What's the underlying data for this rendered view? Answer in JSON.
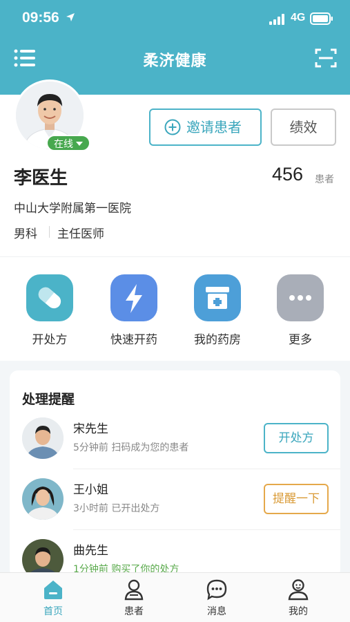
{
  "status_bar": {
    "time": "09:56",
    "network": "4G"
  },
  "navbar": {
    "title": "柔济健康"
  },
  "profile": {
    "online_label": "在线",
    "invite_label": "邀请患者",
    "performance_label": "绩效",
    "name": "李医生",
    "patient_count": "456",
    "patient_unit": "患者",
    "hospital": "中山大学附属第一医院",
    "department": "男科",
    "title": "主任医师"
  },
  "quick_actions": [
    {
      "label": "开处方",
      "icon": "pill-icon",
      "color": "#4bb3c8"
    },
    {
      "label": "快速开药",
      "icon": "lightning-icon",
      "color": "#5b8ee6"
    },
    {
      "label": "我的药房",
      "icon": "pharmacy-icon",
      "color": "#4d9fd8"
    },
    {
      "label": "更多",
      "icon": "more-icon",
      "color": "#a9aeb8"
    }
  ],
  "reminders": {
    "title": "处理提醒",
    "items": [
      {
        "name": "宋先生",
        "desc": "5分钟前  扫码成为您的患者",
        "action": "开处方"
      },
      {
        "name": "王小姐",
        "desc": "3小时前  已开出处方",
        "action": "提醒一下"
      },
      {
        "name": "曲先生",
        "desc": "1分钟前  购买了你的处方",
        "action": ""
      }
    ]
  },
  "tabbar": {
    "items": [
      {
        "label": "首页",
        "icon": "home-icon"
      },
      {
        "label": "患者",
        "icon": "patient-icon"
      },
      {
        "label": "消息",
        "icon": "message-icon"
      },
      {
        "label": "我的",
        "icon": "profile-icon"
      }
    ]
  },
  "colors": {
    "primary": "#4bb3c8",
    "online_green": "#47a84e",
    "warning": "#e5a84a"
  }
}
